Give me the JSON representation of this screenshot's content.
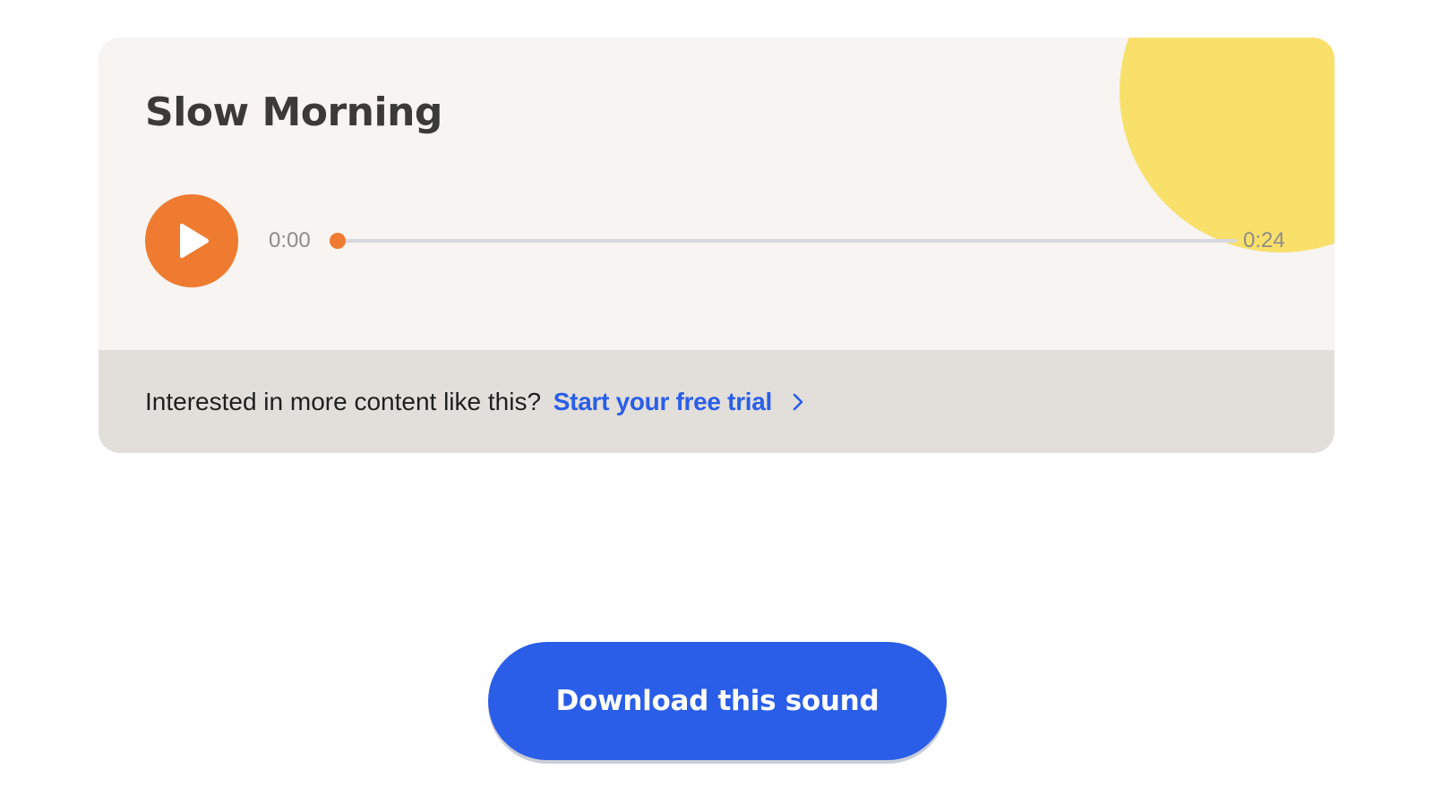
{
  "player": {
    "title": "Slow Morning",
    "current_time": "0:00",
    "total_time": "0:24",
    "progress": 0,
    "play_icon": "play-icon",
    "accent_color": "#ee7b30",
    "decoration_color": "#f9e06b"
  },
  "promo": {
    "text": "Interested in more content like this?",
    "link_label": "Start your free trial",
    "link_icon": "chevron-right-icon",
    "link_color": "#2a5ee8"
  },
  "download": {
    "label": "Download this sound",
    "color": "#2a5ee8"
  }
}
